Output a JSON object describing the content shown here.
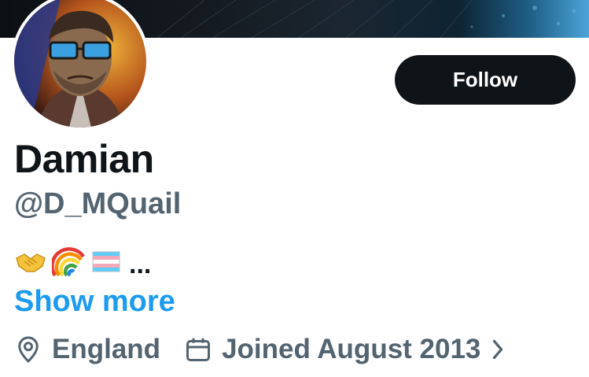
{
  "profile": {
    "display_name": "Damian",
    "handle": "@D_MQuail",
    "bio": {
      "emojis": [
        "handshake-emoji",
        "rainbow-emoji",
        "transgender-flag-emoji"
      ],
      "truncation": "..."
    },
    "show_more_label": "Show more",
    "location": "England",
    "joined": "Joined August 2013"
  },
  "actions": {
    "follow_label": "Follow"
  },
  "icons": {
    "location": "location-pin-icon",
    "calendar": "calendar-icon",
    "chevron": "chevron-right-icon"
  },
  "colors": {
    "primary_text": "#0f1419",
    "secondary_text": "#536471",
    "link": "#1d9bf0",
    "follow_button_bg": "#0f1419",
    "follow_button_text": "#ffffff"
  }
}
